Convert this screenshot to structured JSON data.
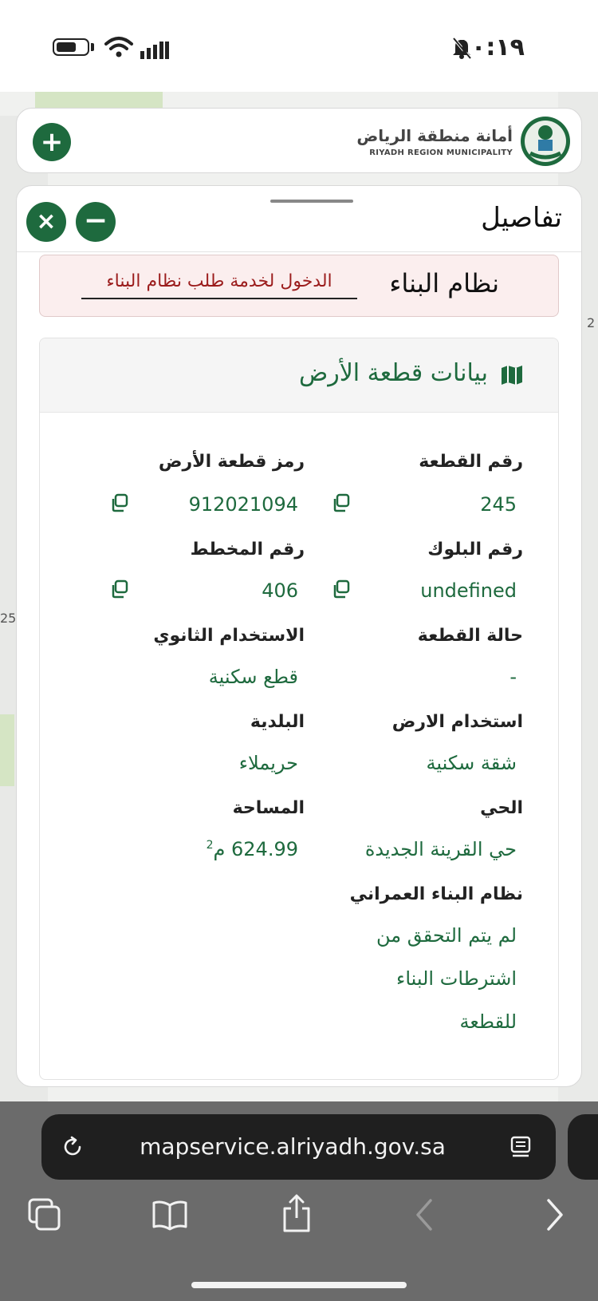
{
  "status_bar": {
    "time": "١٠:١٩"
  },
  "header": {
    "brand_ar": "أمانة منطقة الرياض",
    "brand_en": "RIYADH REGION MUNICIPALITY",
    "add_symbol": "+"
  },
  "panel": {
    "title": "تفاصيل",
    "close_symbol": "×",
    "minimize_symbol": "−"
  },
  "building_system": {
    "label": "نظام البناء",
    "link": "الدخول لخدمة طلب نظام البناء"
  },
  "land_data": {
    "title": "بيانات قطعة الأرض",
    "fields": {
      "plot_number": {
        "label": "رقم القطعة",
        "value": "245"
      },
      "land_code": {
        "label": "رمز قطعة الأرض",
        "value": "912021094"
      },
      "block_number": {
        "label": "رقم البلوك",
        "value": "undefined"
      },
      "plan_number": {
        "label": "رقم المخطط",
        "value": "406"
      },
      "plot_status": {
        "label": "حالة القطعة",
        "value": "-"
      },
      "secondary_use": {
        "label": "الاستخدام الثانوي",
        "value": "قطع سكنية"
      },
      "land_use": {
        "label": "استخدام الارض",
        "value": "شقة سكنية"
      },
      "municipality": {
        "label": "البلدية",
        "value": "حريملاء"
      },
      "district": {
        "label": "الحي",
        "value": "حي القرينة الجديدة"
      },
      "area": {
        "label": "المساحة",
        "value": "624.99",
        "unit": "م",
        "unit_sup": "2"
      },
      "urban_system": {
        "label": "نظام البناء العمراني",
        "value_lines": [
          "لم يتم التحقق من",
          "اشترطات البناء",
          "للقطعة"
        ]
      }
    }
  },
  "map": {
    "edge_label_1": "2",
    "edge_label_2": "25"
  },
  "browser": {
    "url": "mapservice.alriyadh.gov.sa"
  },
  "colors": {
    "brand_green": "#1e6a3e",
    "link_red": "#9b1c1c",
    "warning_bg": "#fbeeee"
  }
}
